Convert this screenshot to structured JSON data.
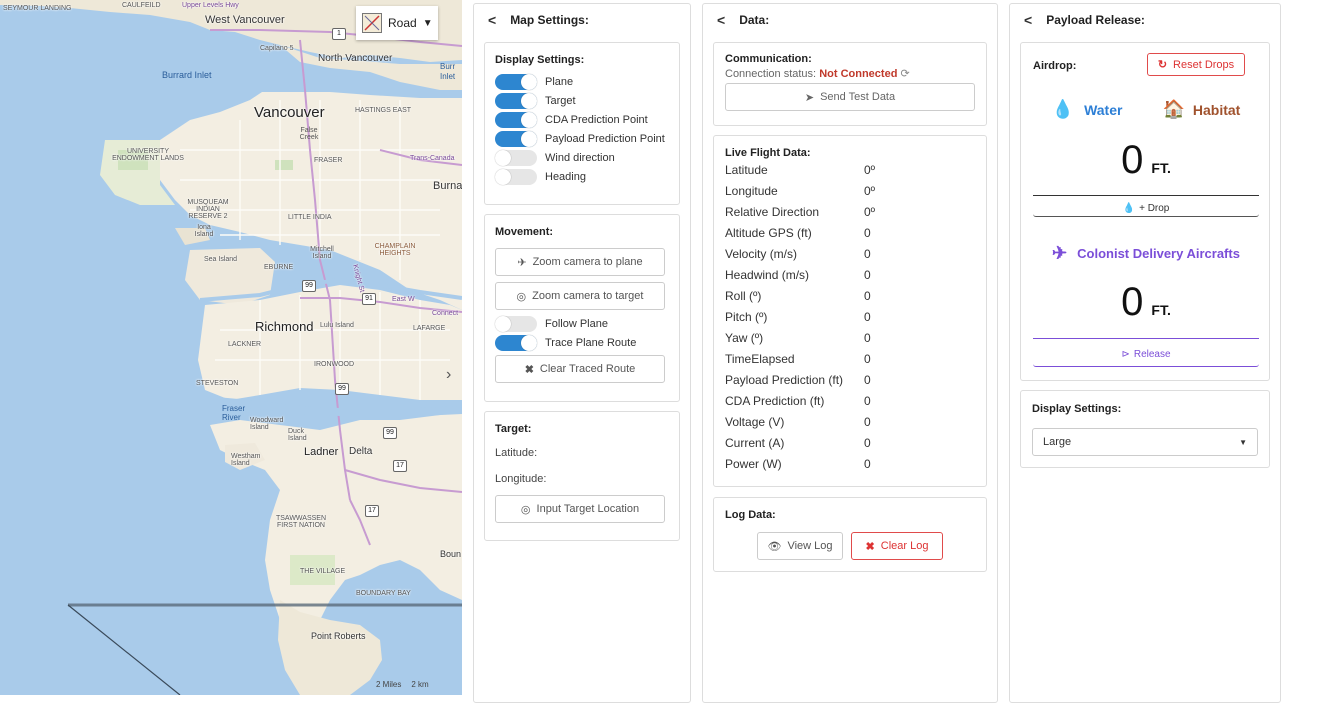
{
  "map": {
    "layer_select": "Road",
    "labels": {
      "seymour": "SEYMOUR LANDING",
      "caulfeild": "CAULFEILD",
      "upper_levels": "Upper Levels Hwy",
      "west_vancouver": "West Vancouver",
      "capilano": "Capilano 5",
      "north_vancouver": "North Vancouver",
      "burrard_inlet": "Burrard Inlet",
      "burr": "Burr",
      "inlet": "Inlet",
      "vancouver": "Vancouver",
      "hastings_east": "HASTINGS EAST",
      "false_creek": "False Creek",
      "university": "UNIVERSITY ENDOWMENT LANDS",
      "fraser": "FRASER",
      "trans_canada": "Trans-Canada",
      "burna": "Burna",
      "musqueam": "MUSQUEAM INDIAN RESERVE 2",
      "iona": "Iona Island",
      "little_india": "LITTLE INDIA",
      "sea_island": "Sea Island",
      "eburne": "EBURNE",
      "mitchell": "Mitchell Island",
      "champlain": "CHAMPLAIN HEIGHTS",
      "knight": "Knight St",
      "east_w": "East W",
      "connect": "Connect",
      "richmond": "Richmond",
      "lulu": "Lulu Island",
      "lafarge": "LAFARGE",
      "lackner": "LACKNER",
      "ironwood": "IRONWOOD",
      "steveston": "STEVESTON",
      "fraser_river": "Fraser River",
      "woodward": "Woodward Island",
      "duck": "Duck Island",
      "westham": "Westham Island",
      "ladner": "Ladner",
      "delta": "Delta",
      "tsawwassen": "TSAWWASSEN FIRST NATION",
      "boun": "Boun",
      "the_village": "THE VILLAGE",
      "boundary_bay": "BOUNDARY BAY",
      "point_roberts": "Point Roberts"
    },
    "shields": [
      "1",
      "99",
      "91",
      "99",
      "99",
      "17",
      "17"
    ],
    "scale_miles": "2 Miles",
    "scale_km": "2 km"
  },
  "map_settings": {
    "title": "Map Settings:",
    "display": {
      "title": "Display Settings:",
      "toggles": [
        {
          "label": "Plane",
          "on": true
        },
        {
          "label": "Target",
          "on": true
        },
        {
          "label": "CDA Prediction Point",
          "on": true
        },
        {
          "label": "Payload Prediction Point",
          "on": true
        },
        {
          "label": "Wind direction",
          "on": false
        },
        {
          "label": "Heading",
          "on": false
        }
      ]
    },
    "movement": {
      "title": "Movement:",
      "zoom_plane": "Zoom camera to plane",
      "zoom_target": "Zoom camera to target",
      "follow_plane": "Follow Plane",
      "follow_plane_on": false,
      "trace_route": "Trace Plane Route",
      "trace_route_on": true,
      "clear_route": "Clear Traced Route"
    },
    "target": {
      "title": "Target:",
      "latitude": "Latitude:",
      "longitude": "Longitude:",
      "input_button": "Input Target Location"
    }
  },
  "data": {
    "title": "Data:",
    "communication": {
      "title": "Communication:",
      "status_label": "Connection status:",
      "status_value": "Not Connected",
      "send_button": "Send Test Data"
    },
    "live": {
      "title": "Live Flight Data:",
      "rows": [
        {
          "k": "Latitude",
          "v": "0º"
        },
        {
          "k": "Longitude",
          "v": "0º"
        },
        {
          "k": "Relative Direction",
          "v": "0º"
        },
        {
          "k": "Altitude GPS (ft)",
          "v": "0"
        },
        {
          "k": "Velocity (m/s)",
          "v": "0"
        },
        {
          "k": "Headwind (m/s)",
          "v": "0"
        },
        {
          "k": "Roll (º)",
          "v": "0"
        },
        {
          "k": "Pitch (º)",
          "v": "0"
        },
        {
          "k": "Yaw (º)",
          "v": "0"
        },
        {
          "k": "TimeElapsed",
          "v": "0"
        },
        {
          "k": "Payload Prediction (ft)",
          "v": "0"
        },
        {
          "k": "CDA Prediction (ft)",
          "v": "0"
        },
        {
          "k": "Voltage (V)",
          "v": "0"
        },
        {
          "k": "Current (A)",
          "v": "0"
        },
        {
          "k": "Power (W)",
          "v": "0"
        }
      ]
    },
    "log": {
      "title": "Log Data:",
      "view": "View Log",
      "clear": "Clear Log"
    }
  },
  "payload": {
    "title": "Payload Release:",
    "airdrop": {
      "title": "Airdrop:",
      "reset": "Reset Drops",
      "water": "Water",
      "habitat": "Habitat",
      "distance1": "0",
      "unit1": "FT.",
      "drop": "+ Drop",
      "cda_title": "Colonist Delivery Aircrafts",
      "distance2": "0",
      "unit2": "FT.",
      "release": "Release"
    },
    "display": {
      "title": "Display Settings:",
      "selected": "Large"
    }
  },
  "colors": {
    "water_blue": "#2d7fd6",
    "habitat_brown": "#a0522d",
    "cda_purple": "#7b4ed8",
    "danger": "#d33"
  }
}
